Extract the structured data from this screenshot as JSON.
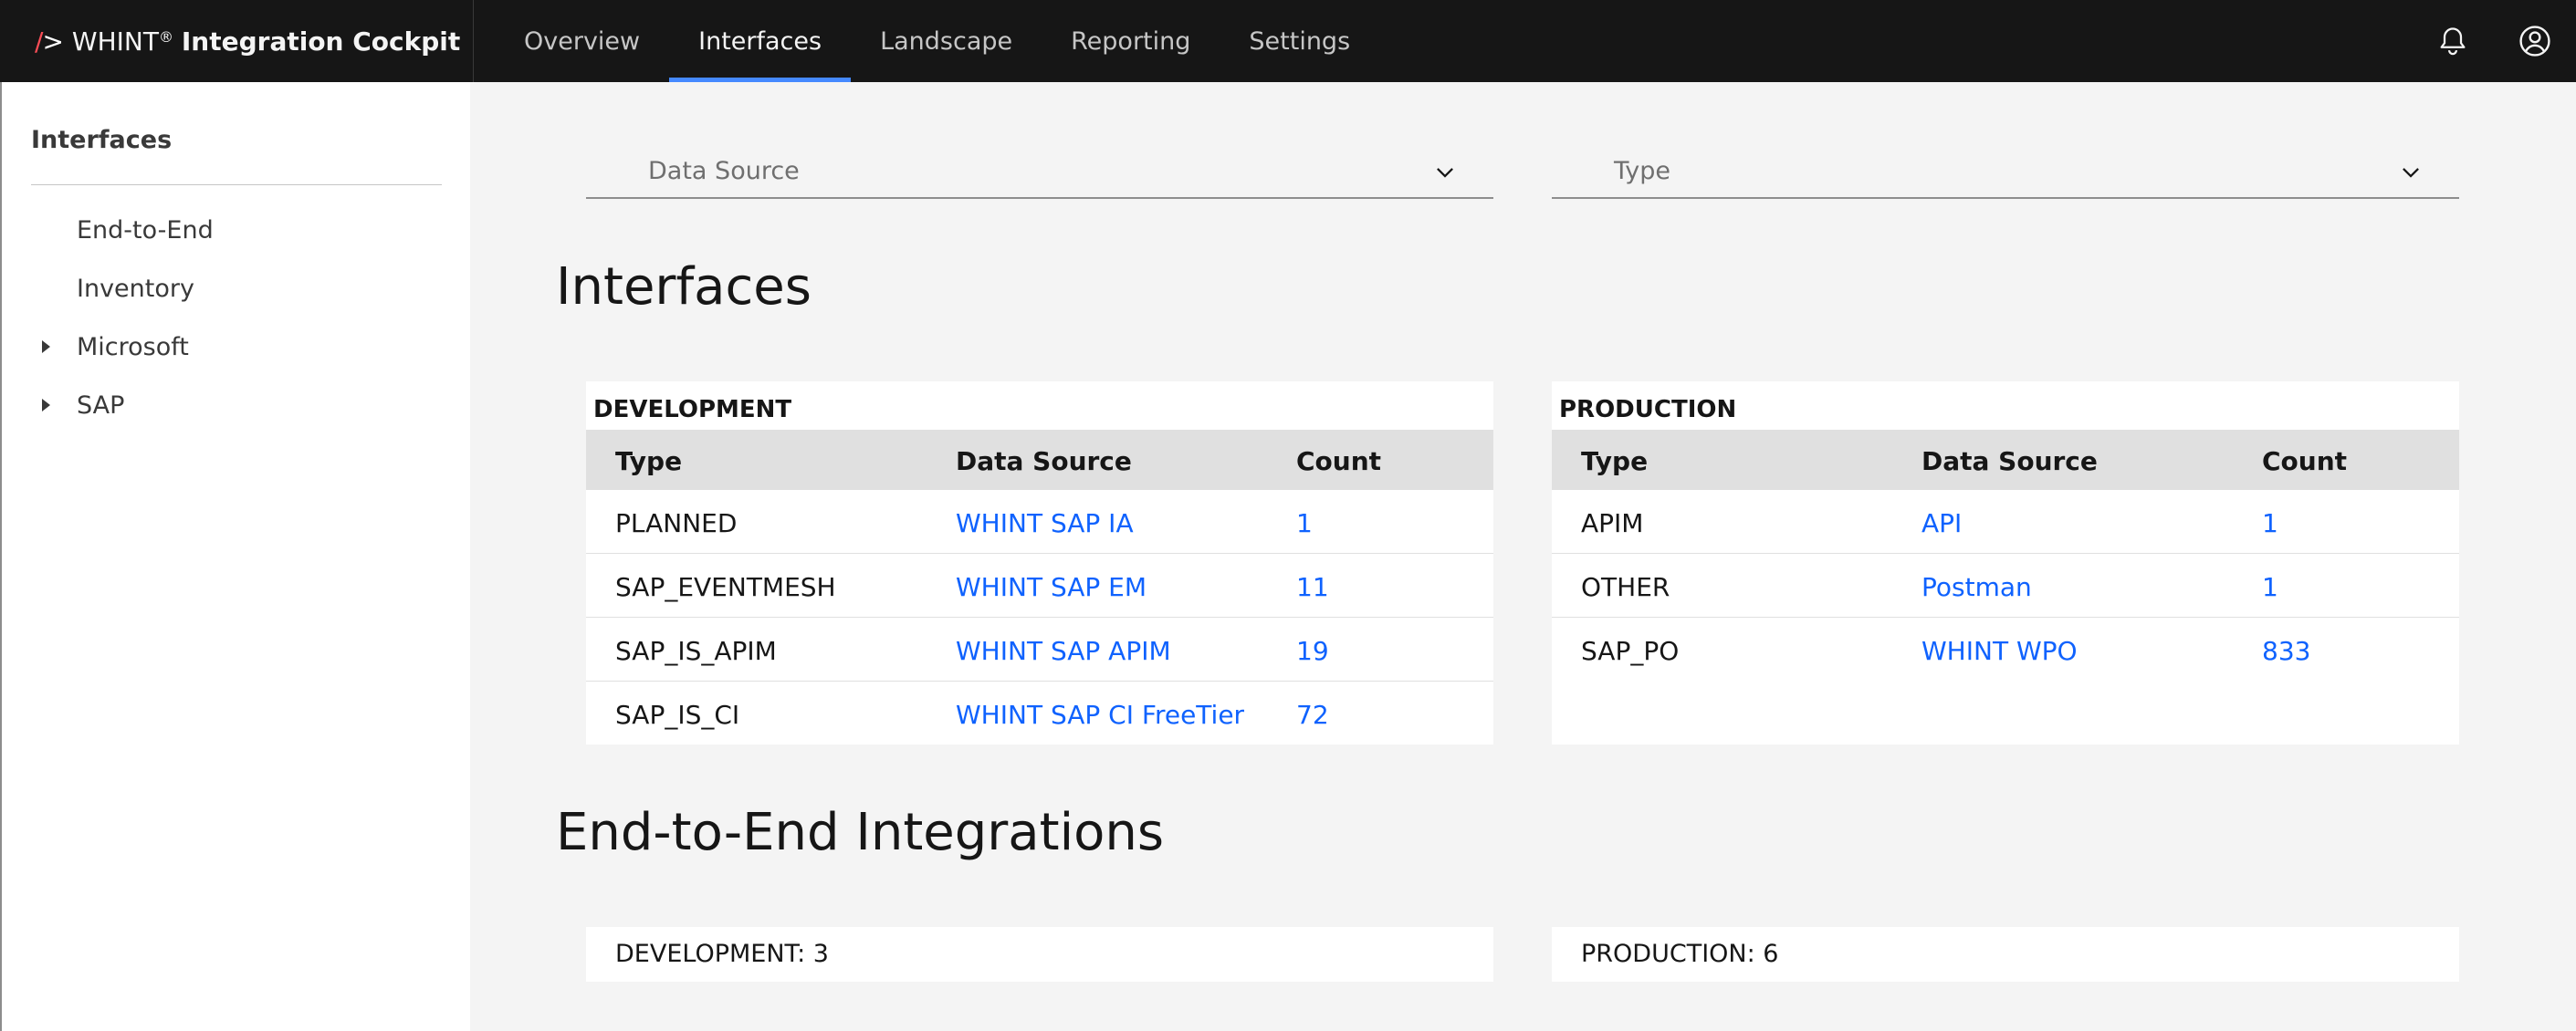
{
  "app": {
    "brand_mark": "/",
    "brand_mark_gt": ">",
    "brand_prefix": "WHINT",
    "brand_reg": "®",
    "brand_suffix": "Integration Cockpit"
  },
  "nav": {
    "items": [
      "Overview",
      "Interfaces",
      "Landscape",
      "Reporting",
      "Settings"
    ],
    "active": "Interfaces"
  },
  "header_icons": [
    "notification-icon",
    "user-avatar-icon"
  ],
  "sidebar": {
    "title": "Interfaces",
    "items": [
      {
        "label": "End-to-End",
        "expandable": false
      },
      {
        "label": "Inventory",
        "expandable": false
      },
      {
        "label": "Microsoft",
        "expandable": true
      },
      {
        "label": "SAP",
        "expandable": true
      }
    ]
  },
  "filters": {
    "data_source_placeholder": "Data Source",
    "type_placeholder": "Type"
  },
  "interfaces": {
    "title": "Interfaces",
    "columns": [
      "Type",
      "Data Source",
      "Count"
    ],
    "development": {
      "title": "DEVELOPMENT",
      "rows": [
        {
          "type": "PLANNED",
          "source": "WHINT SAP IA",
          "count": "1"
        },
        {
          "type": "SAP_EVENTMESH",
          "source": "WHINT SAP EM",
          "count": "11"
        },
        {
          "type": "SAP_IS_APIM",
          "source": "WHINT SAP APIM",
          "count": "19"
        },
        {
          "type": "SAP_IS_CI",
          "source": "WHINT SAP CI FreeTier",
          "count": "72"
        }
      ]
    },
    "production": {
      "title": "PRODUCTION",
      "rows": [
        {
          "type": "APIM",
          "source": "API",
          "count": "1"
        },
        {
          "type": "OTHER",
          "source": "Postman",
          "count": "1"
        },
        {
          "type": "SAP_PO",
          "source": "WHINT WPO",
          "count": "833"
        }
      ]
    }
  },
  "e2e": {
    "title": "End-to-End Integrations",
    "development": "DEVELOPMENT: 3",
    "production": "PRODUCTION: 6"
  },
  "colors": {
    "header_bg": "#161616",
    "accent": "#4589ff",
    "link": "#0f62fe",
    "brand_mark": "#fa4d56"
  }
}
